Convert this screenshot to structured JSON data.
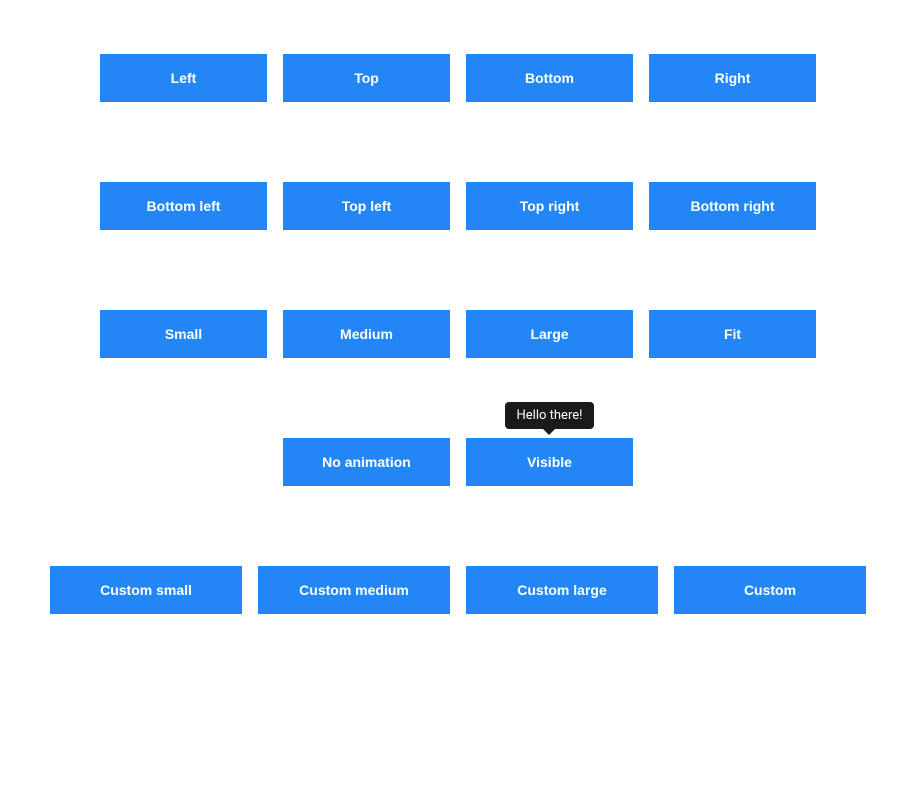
{
  "row1": {
    "left": "Left",
    "top": "Top",
    "bottom": "Bottom",
    "right": "Right"
  },
  "row2": {
    "bottom_left": "Bottom left",
    "top_left": "Top left",
    "top_right": "Top right",
    "bottom_right": "Bottom right"
  },
  "row3": {
    "small": "Small",
    "medium": "Medium",
    "large": "Large",
    "fit": "Fit"
  },
  "row4": {
    "no_animation": "No animation",
    "visible": "Visible"
  },
  "tooltip": {
    "text": "Hello there!"
  },
  "row5": {
    "custom_small": "Custom small",
    "custom_medium": "Custom medium",
    "custom_large": "Custom large",
    "custom": "Custom"
  }
}
